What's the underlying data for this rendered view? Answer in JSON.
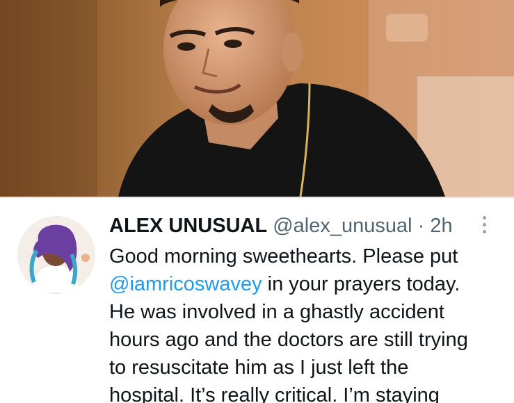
{
  "tweet": {
    "display_name": "ALEX UNUSUAL",
    "handle": "@alex_unusual",
    "separator": "·",
    "time": "2h",
    "mention": "@iamricoswavey",
    "lines": [
      "Good morning sweethearts. Please put",
      " in your prayers today.",
      "He was involved in a ghastly accident",
      "hours ago and the doctors are still trying",
      "to resuscitate him as I just left the",
      "hospital. It’s really critical. I’m staying"
    ]
  },
  "icons": {
    "more": "more-vertical-icon"
  },
  "colors": {
    "text": "#0f1419",
    "secondary": "#536471",
    "link": "#1d9bf0"
  }
}
